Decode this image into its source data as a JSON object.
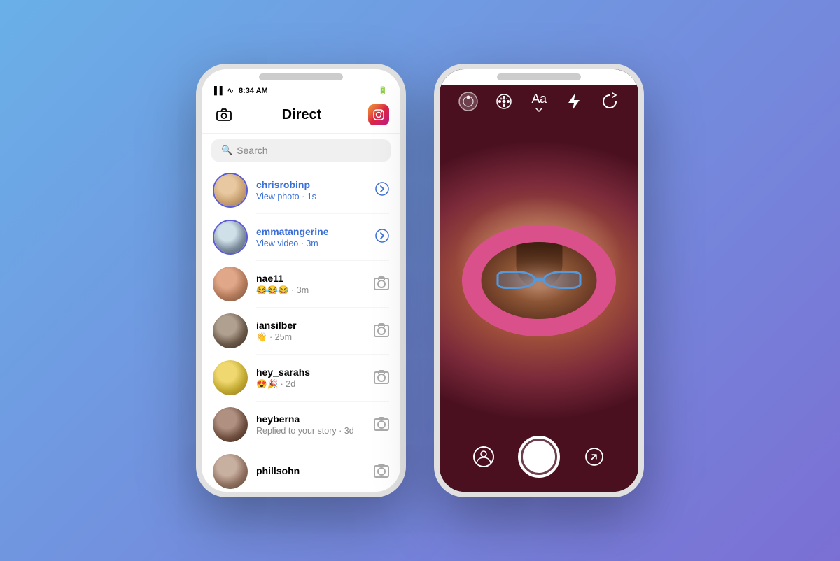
{
  "background": {
    "color_left": "#6ab0e8",
    "color_right": "#7b6fd4"
  },
  "phone_left": {
    "status_bar": {
      "time": "8:34 AM",
      "signal": "▌▌▌",
      "wifi": "WiFi",
      "battery": "Battery"
    },
    "nav": {
      "camera_icon": "📷",
      "title": "Direct",
      "instagram_icon": "📸"
    },
    "search": {
      "placeholder": "Search"
    },
    "messages": [
      {
        "username": "chrisrobinp",
        "preview": "View photo · 1s",
        "action": "arrow",
        "username_color": "blue",
        "preview_color": "blue",
        "avatar_class": "av-img-1"
      },
      {
        "username": "emmatangerine",
        "preview": "View video · 3m",
        "action": "arrow",
        "username_color": "blue",
        "preview_color": "blue",
        "avatar_class": "av-img-2"
      },
      {
        "username": "nae11",
        "preview": "😂😂😂 · 3m",
        "action": "camera",
        "username_color": "black",
        "preview_color": "gray",
        "avatar_class": "av-img-3"
      },
      {
        "username": "iansilber",
        "preview": "👋 · 25m",
        "action": "camera",
        "username_color": "black",
        "preview_color": "gray",
        "avatar_class": "av-img-4"
      },
      {
        "username": "hey_sarahs",
        "preview": "😍🎉 · 2d",
        "action": "camera",
        "username_color": "black",
        "preview_color": "gray",
        "avatar_class": "av-img-5"
      },
      {
        "username": "heyberna",
        "preview": "Replied to your story · 3d",
        "action": "camera",
        "username_color": "black",
        "preview_color": "gray",
        "avatar_class": "av-img-6"
      },
      {
        "username": "phillsohn",
        "preview": "",
        "action": "camera",
        "username_color": "black",
        "preview_color": "gray",
        "avatar_class": "av-img-7"
      }
    ]
  },
  "phone_right": {
    "top_controls": [
      {
        "icon": "👤",
        "label": "gallery",
        "type": "icon"
      },
      {
        "icon": "✨",
        "label": "effects",
        "type": "icon"
      },
      {
        "icon": "Aa",
        "label": "text",
        "type": "text"
      },
      {
        "icon": "⚡",
        "label": "flash",
        "type": "icon"
      },
      {
        "icon": "🔄",
        "label": "flip",
        "type": "icon"
      }
    ],
    "bottom_controls": [
      {
        "icon": "👤",
        "label": "profile"
      },
      {
        "icon": "⬤",
        "label": "shutter"
      },
      {
        "icon": "➤",
        "label": "send"
      }
    ]
  }
}
